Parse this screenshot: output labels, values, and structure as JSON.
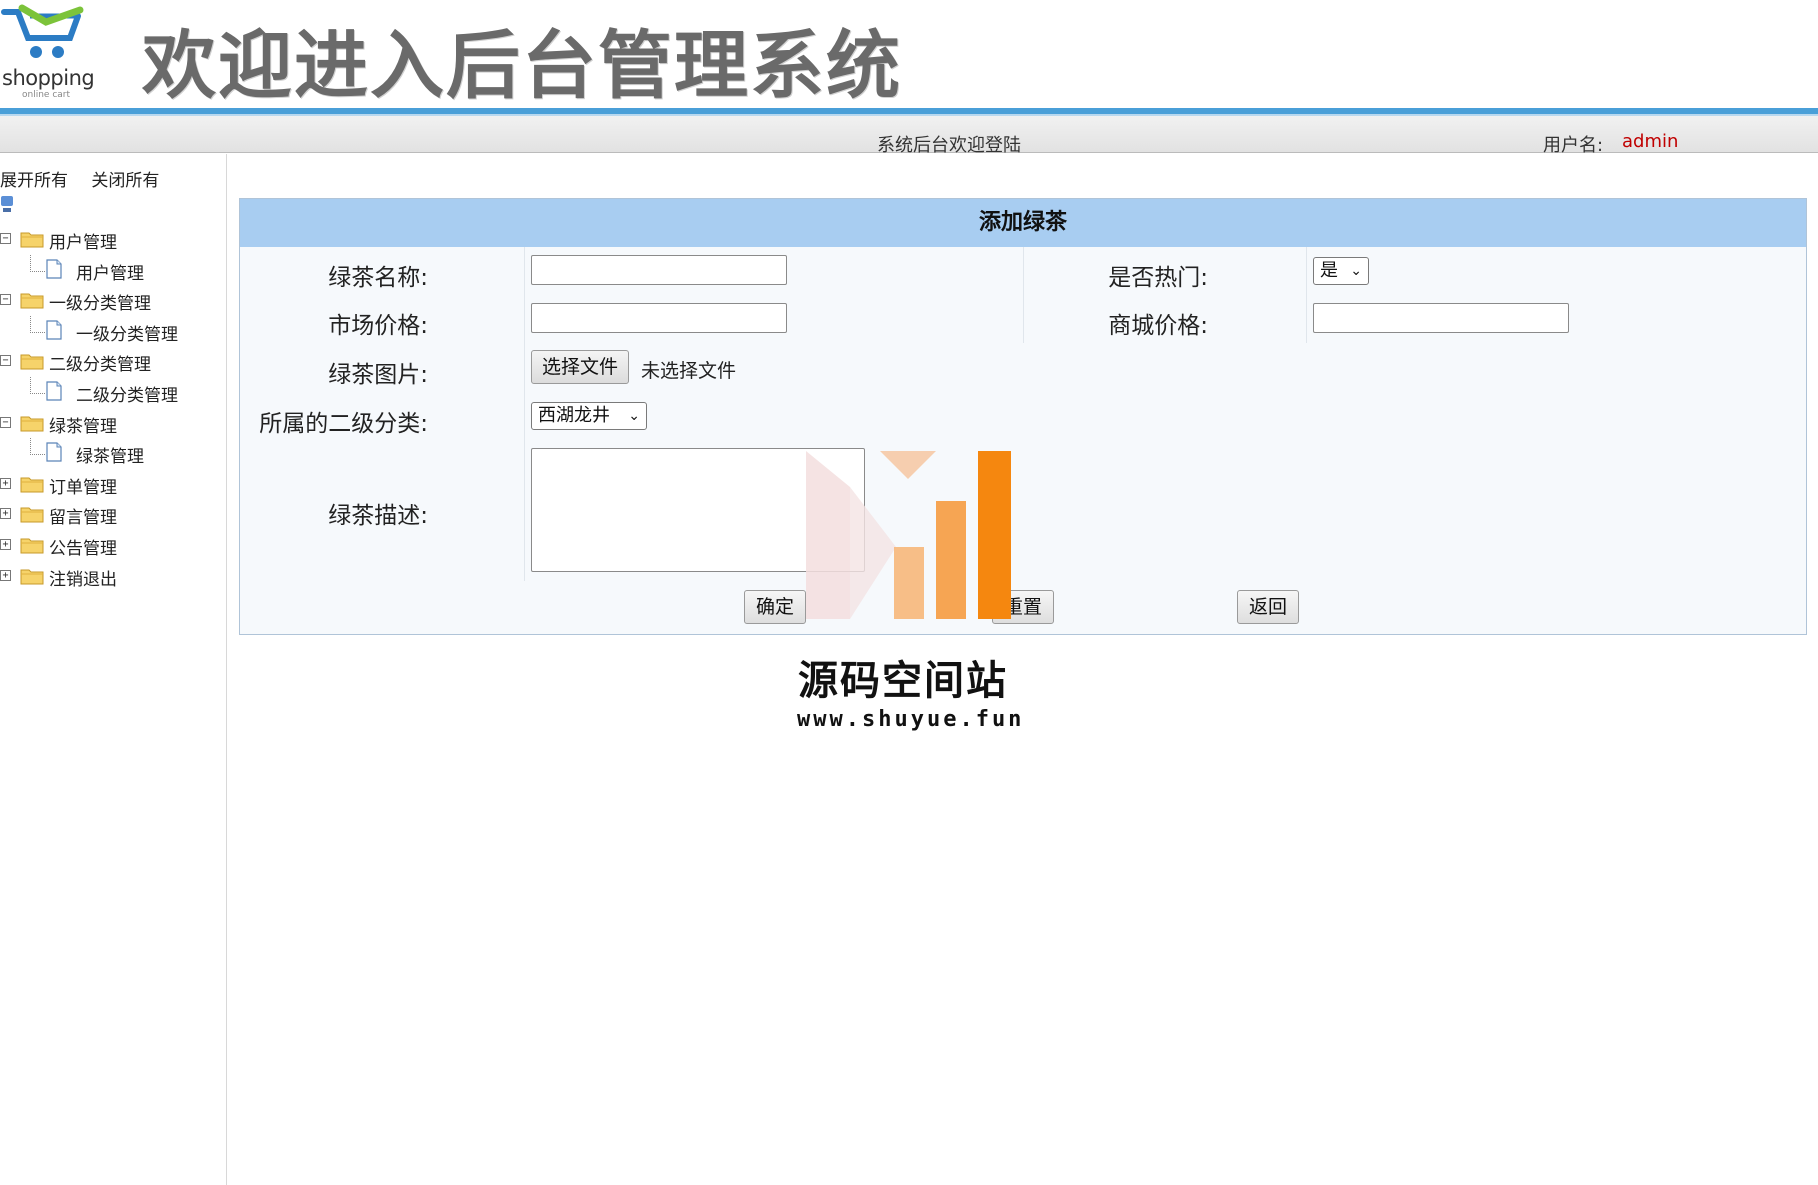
{
  "header": {
    "logo_text": "shopping",
    "logo_subtext": "online cart",
    "title": "欢迎进入后台管理系统"
  },
  "statusbar": {
    "welcome": "系统后台欢迎登陆",
    "user_label": "用户名:",
    "user_name": "admin"
  },
  "sidebar": {
    "expand_all": "展开所有",
    "collapse_all": "关闭所有",
    "items": [
      {
        "label": "用户管理",
        "expanded": true,
        "children": [
          "用户管理"
        ]
      },
      {
        "label": "一级分类管理",
        "expanded": true,
        "children": [
          "一级分类管理"
        ]
      },
      {
        "label": "二级分类管理",
        "expanded": true,
        "children": [
          "二级分类管理"
        ]
      },
      {
        "label": "绿茶管理",
        "expanded": true,
        "children": [
          "绿茶管理"
        ]
      },
      {
        "label": "订单管理",
        "expanded": false,
        "children": []
      },
      {
        "label": "留言管理",
        "expanded": false,
        "children": []
      },
      {
        "label": "公告管理",
        "expanded": false,
        "children": []
      },
      {
        "label": "注销退出",
        "expanded": false,
        "children": []
      }
    ]
  },
  "form": {
    "title": "添加绿茶",
    "name_label": "绿茶名称:",
    "name_value": "",
    "hot_label": "是否热门:",
    "hot_value": "是",
    "market_price_label": "市场价格:",
    "market_price_value": "",
    "shop_price_label": "商城价格:",
    "shop_price_value": "",
    "image_label": "绿茶图片:",
    "file_button": "选择文件",
    "file_status": "未选择文件",
    "category_label": "所属的二级分类:",
    "category_value": "西湖龙井",
    "desc_label": "绿茶描述:",
    "desc_value": "",
    "confirm_button": "确定",
    "reset_button": "重置",
    "back_button": "返回"
  },
  "watermark": {
    "name": "源码空间站",
    "url": "www.shuyue.fun"
  },
  "colors": {
    "header_line": "#4a9fd8",
    "panel_head": "#a8cdf1",
    "admin_text": "#c00000",
    "watermark_orange": "#f5870f"
  }
}
